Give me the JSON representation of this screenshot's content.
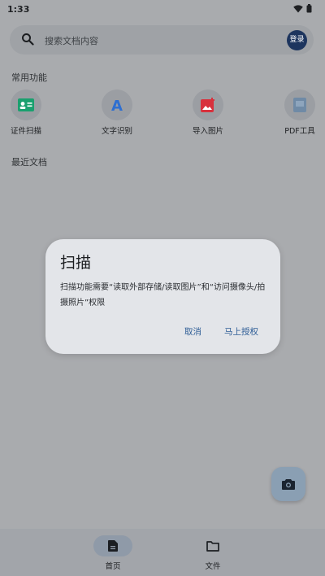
{
  "status": {
    "time": "1:33"
  },
  "search": {
    "placeholder": "搜索文档内容",
    "login_label": "登录"
  },
  "sections": {
    "common_features": "常用功能",
    "recent_docs": "最近文档"
  },
  "tools": [
    {
      "label": "证件扫描",
      "icon": "id-card-icon",
      "color": "#1aa06f"
    },
    {
      "label": "文字识别",
      "icon": "letter-a-icon",
      "color": "#2e6fd1"
    },
    {
      "label": "导入图片",
      "icon": "image-import-icon",
      "color": "#d8313d"
    },
    {
      "label": "PDF工具",
      "icon": "pdf-file-icon",
      "color": "#6f8aa6"
    }
  ],
  "dialog": {
    "title": "扫描",
    "message": "扫描功能需要“读取外部存储/读取图片”和“访问摄像头/拍摄照片”权限",
    "cancel_label": "取消",
    "confirm_label": "马上授权"
  },
  "fab": {
    "icon": "camera-icon"
  },
  "bottom_nav": {
    "items": [
      {
        "label": "首页",
        "icon": "document-icon",
        "active": true
      },
      {
        "label": "文件",
        "icon": "folder-icon",
        "active": false
      }
    ]
  }
}
